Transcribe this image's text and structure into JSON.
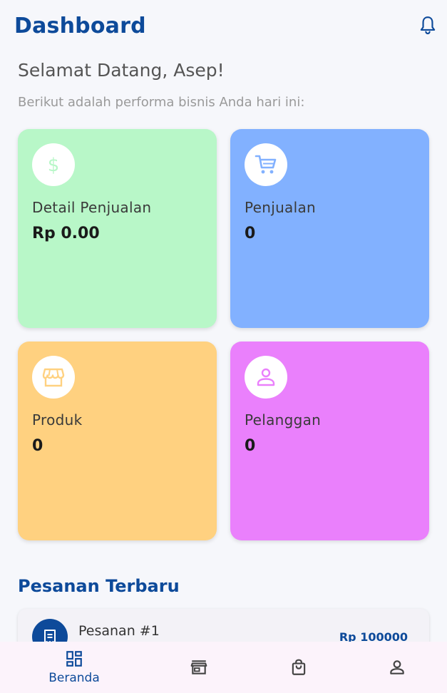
{
  "header": {
    "title": "Dashboard",
    "icon": "bell-icon"
  },
  "greeting": "Selamat Datang, Asep!",
  "subtitle": "Berikut adalah performa bisnis Anda hari ini:",
  "colors": {
    "brand": "#0d4a9a",
    "card_sales_detail": "#b8f7c8",
    "card_sales": "#82b1ff",
    "card_products": "#ffd180",
    "card_customers": "#ea80fc"
  },
  "cards": [
    {
      "label": "Detail Penjualan",
      "value": "Rp 0.00",
      "icon": "dollar-icon"
    },
    {
      "label": "Penjualan",
      "value": "0",
      "icon": "cart-icon"
    },
    {
      "label": "Produk",
      "value": "0",
      "icon": "store-icon"
    },
    {
      "label": "Pelanggan",
      "value": "0",
      "icon": "person-icon"
    }
  ],
  "recent_orders": {
    "title": "Pesanan Terbaru",
    "items": [
      {
        "name": "Pesanan #1",
        "amount": "Rp 100000",
        "icon": "receipt-icon"
      }
    ]
  },
  "bottom_nav": [
    {
      "label": "Beranda",
      "icon": "dashboard-icon",
      "active": true
    },
    {
      "label": "",
      "icon": "store-icon",
      "active": false
    },
    {
      "label": "",
      "icon": "shopping-bag-icon",
      "active": false
    },
    {
      "label": "",
      "icon": "person-icon",
      "active": false
    }
  ]
}
